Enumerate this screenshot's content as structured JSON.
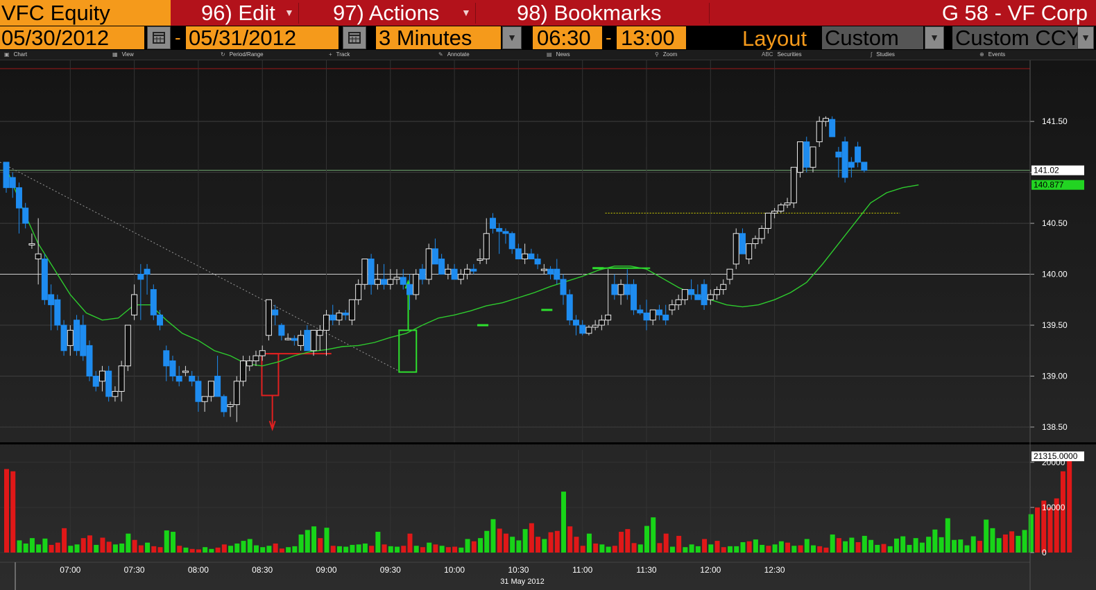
{
  "topbar": {
    "security": "VFC Equity",
    "menu_edit": "96) Edit",
    "menu_actions": "97) Actions",
    "menu_bookmarks": "98) Bookmarks",
    "function_title": "G 58 - VF Corp"
  },
  "controls": {
    "start_date": "05/30/2012",
    "end_date": "05/31/2012",
    "interval": "3 Minutes",
    "start_time": "06:30",
    "end_time": "13:00",
    "layout_label": "Layout",
    "layout_value": "Custom",
    "currency_value": "Custom CCY"
  },
  "toolbar": [
    "Chart",
    "View",
    "Period/Range",
    "Track",
    "Annotate",
    "News",
    "Zoom",
    "Securities",
    "Studies",
    "Events"
  ],
  "colors": {
    "up": "#ffffff",
    "down": "#1e8cf0",
    "ma": "#2ecc2e",
    "vol_up": "#18d418",
    "vol_down": "#e01818",
    "orange": "#f59a1b",
    "red_bar": "#b3121b"
  },
  "chart_data": {
    "type": "candlestick",
    "date_label": "31 May 2012",
    "x_ticks": [
      "07:00",
      "07:30",
      "08:00",
      "08:30",
      "09:00",
      "09:30",
      "10:00",
      "10:30",
      "11:00",
      "11:30",
      "12:00",
      "12:30"
    ],
    "price_ticks": [
      "141.50",
      "141.00",
      "140.50",
      "140.00",
      "139.50",
      "139.00",
      "138.50"
    ],
    "price_range": [
      138.35,
      142.1
    ],
    "volume_ticks": [
      "20000",
      "10000",
      "0"
    ],
    "volume_range": [
      0,
      21500
    ],
    "last_price": "141.02",
    "ma_last": "140.877",
    "volume_last": "21315.0000",
    "time_start": "06:30",
    "bar_minutes": 3,
    "ohlc": [
      [
        141.1,
        141.08,
        140.8,
        140.85
      ],
      [
        140.95,
        141.0,
        140.75,
        140.85
      ],
      [
        140.85,
        140.9,
        140.4,
        140.65
      ],
      [
        140.65,
        140.7,
        140.45,
        140.5
      ],
      [
        140.3,
        140.4,
        140.25,
        140.3
      ],
      [
        140.15,
        140.55,
        139.9,
        140.2
      ],
      [
        140.15,
        140.2,
        139.7,
        139.75
      ],
      [
        139.8,
        139.9,
        139.45,
        139.7
      ],
      [
        139.75,
        139.8,
        139.45,
        139.5
      ],
      [
        139.5,
        139.55,
        139.2,
        139.25
      ],
      [
        139.3,
        139.5,
        139.2,
        139.45
      ],
      [
        139.55,
        139.6,
        139.2,
        139.25
      ],
      [
        139.5,
        139.6,
        139.15,
        139.2
      ],
      [
        139.3,
        139.35,
        138.95,
        139.0
      ],
      [
        139.0,
        139.05,
        138.85,
        138.9
      ],
      [
        138.95,
        139.1,
        138.85,
        139.05
      ],
      [
        139.05,
        139.1,
        138.75,
        138.8
      ],
      [
        138.8,
        138.9,
        138.75,
        138.85
      ],
      [
        138.85,
        139.15,
        138.75,
        139.1
      ],
      [
        139.1,
        139.5,
        139.05,
        139.5
      ],
      [
        139.6,
        139.9,
        139.55,
        139.8
      ],
      [
        140.0,
        140.1,
        139.55,
        139.95
      ],
      [
        140.05,
        140.1,
        139.8,
        140.0
      ],
      [
        139.85,
        139.9,
        139.55,
        139.6
      ],
      [
        139.6,
        139.65,
        139.45,
        139.5
      ],
      [
        139.25,
        139.3,
        138.95,
        139.1
      ],
      [
        139.15,
        139.2,
        138.95,
        139.0
      ],
      [
        139.0,
        139.1,
        138.9,
        138.95
      ],
      [
        139.05,
        139.1,
        139.0,
        139.05
      ],
      [
        139.0,
        139.05,
        138.9,
        138.95
      ],
      [
        138.95,
        139.0,
        138.65,
        138.75
      ],
      [
        138.75,
        138.8,
        138.65,
        138.8
      ],
      [
        138.8,
        138.95,
        138.75,
        138.95
      ],
      [
        139.0,
        139.2,
        138.8,
        138.8
      ],
      [
        138.8,
        138.82,
        138.6,
        138.65
      ],
      [
        138.7,
        138.75,
        138.6,
        138.72
      ],
      [
        138.72,
        139.0,
        138.55,
        138.95
      ],
      [
        138.95,
        139.2,
        138.9,
        139.15
      ],
      [
        139.1,
        139.2,
        139.05,
        139.15
      ],
      [
        139.15,
        139.25,
        139.1,
        139.2
      ],
      [
        139.2,
        139.3,
        139.15,
        139.25
      ],
      [
        139.4,
        139.75,
        139.35,
        139.75
      ],
      [
        139.65,
        139.7,
        139.5,
        139.6
      ],
      [
        139.5,
        139.52,
        139.35,
        139.4
      ],
      [
        139.37,
        139.42,
        139.35,
        139.37
      ],
      [
        139.37,
        139.4,
        139.3,
        139.35
      ],
      [
        139.3,
        139.45,
        139.25,
        139.4
      ],
      [
        139.45,
        139.5,
        139.3,
        139.25
      ],
      [
        139.25,
        139.35,
        139.2,
        139.45
      ],
      [
        139.4,
        139.5,
        139.25,
        139.45
      ],
      [
        139.45,
        139.65,
        139.2,
        139.6
      ],
      [
        139.6,
        139.7,
        139.5,
        139.55
      ],
      [
        139.55,
        139.65,
        139.5,
        139.62
      ],
      [
        139.62,
        139.65,
        139.55,
        139.6
      ],
      [
        139.55,
        139.75,
        139.5,
        139.75
      ],
      [
        139.75,
        139.95,
        139.7,
        139.9
      ],
      [
        139.9,
        140.15,
        139.85,
        140.15
      ],
      [
        140.15,
        140.2,
        139.8,
        139.9
      ],
      [
        139.9,
        140.1,
        139.85,
        139.95
      ],
      [
        139.95,
        140.1,
        139.85,
        139.9
      ],
      [
        139.9,
        140.05,
        139.85,
        139.95
      ],
      [
        139.95,
        140.05,
        139.9,
        139.97
      ],
      [
        139.97,
        140.05,
        139.85,
        139.9
      ],
      [
        139.9,
        140.0,
        139.65,
        139.8
      ],
      [
        139.8,
        140.05,
        139.75,
        140.0
      ],
      [
        140.05,
        140.1,
        139.9,
        139.95
      ],
      [
        139.95,
        140.3,
        139.9,
        140.25
      ],
      [
        140.25,
        140.35,
        140.1,
        140.1
      ],
      [
        140.15,
        140.2,
        140.0,
        140.0
      ],
      [
        140.0,
        140.1,
        139.95,
        140.05
      ],
      [
        140.05,
        140.1,
        139.95,
        139.95
      ],
      [
        139.95,
        140.05,
        139.9,
        140.0
      ],
      [
        140.0,
        140.1,
        139.95,
        140.05
      ],
      [
        140.05,
        140.1,
        140.0,
        140.03
      ],
      [
        140.15,
        140.25,
        140.1,
        140.15
      ],
      [
        140.15,
        140.55,
        140.1,
        140.4
      ],
      [
        140.55,
        140.6,
        140.4,
        140.45
      ],
      [
        140.45,
        140.5,
        140.2,
        140.42
      ],
      [
        140.42,
        140.45,
        140.3,
        140.4
      ],
      [
        140.4,
        140.42,
        140.2,
        140.25
      ],
      [
        140.25,
        140.3,
        140.15,
        140.15
      ],
      [
        140.15,
        140.3,
        140.1,
        140.2
      ],
      [
        140.2,
        140.25,
        140.15,
        140.15
      ],
      [
        140.15,
        140.2,
        140.05,
        140.1
      ],
      [
        140.05,
        140.1,
        140.0,
        140.05
      ],
      [
        140.05,
        140.08,
        139.95,
        140.0
      ],
      [
        140.05,
        140.15,
        139.9,
        139.95
      ],
      [
        139.95,
        140.0,
        139.7,
        139.8
      ],
      [
        139.8,
        139.85,
        139.5,
        139.55
      ],
      [
        139.55,
        139.6,
        139.4,
        139.5
      ],
      [
        139.5,
        139.55,
        139.4,
        139.42
      ],
      [
        139.42,
        139.5,
        139.4,
        139.48
      ],
      [
        139.48,
        139.55,
        139.45,
        139.5
      ],
      [
        139.5,
        139.6,
        139.45,
        139.55
      ],
      [
        139.55,
        140.05,
        139.5,
        139.6
      ],
      [
        139.9,
        140.0,
        139.75,
        139.8
      ],
      [
        139.8,
        139.95,
        139.7,
        139.9
      ],
      [
        139.9,
        140.05,
        139.75,
        139.8
      ],
      [
        139.9,
        139.95,
        139.6,
        139.65
      ],
      [
        139.65,
        139.7,
        139.6,
        139.62
      ],
      [
        139.62,
        139.75,
        139.45,
        139.55
      ],
      [
        139.55,
        139.65,
        139.5,
        139.65
      ],
      [
        139.65,
        139.7,
        139.55,
        139.6
      ],
      [
        139.6,
        139.7,
        139.5,
        139.55
      ],
      [
        139.65,
        139.75,
        139.6,
        139.7
      ],
      [
        139.7,
        139.8,
        139.65,
        139.75
      ],
      [
        139.75,
        139.85,
        139.7,
        139.85
      ],
      [
        139.85,
        139.95,
        139.75,
        139.8
      ],
      [
        139.8,
        139.9,
        139.75,
        139.75
      ],
      [
        139.9,
        139.95,
        139.65,
        139.7
      ],
      [
        139.75,
        139.85,
        139.7,
        139.8
      ],
      [
        139.8,
        139.88,
        139.75,
        139.85
      ],
      [
        139.85,
        139.95,
        139.8,
        139.9
      ],
      [
        139.95,
        140.05,
        139.9,
        140.05
      ],
      [
        140.1,
        140.45,
        140.05,
        140.4
      ],
      [
        140.4,
        140.45,
        140.2,
        140.2
      ],
      [
        140.15,
        140.3,
        140.1,
        140.3
      ],
      [
        140.3,
        140.38,
        140.25,
        140.35
      ],
      [
        140.35,
        140.48,
        140.3,
        140.45
      ],
      [
        140.45,
        140.6,
        140.4,
        140.6
      ],
      [
        140.6,
        140.65,
        140.55,
        140.62
      ],
      [
        140.62,
        140.7,
        140.6,
        140.68
      ],
      [
        140.68,
        140.75,
        140.65,
        140.7
      ],
      [
        140.7,
        141.05,
        140.65,
        141.05
      ],
      [
        141.0,
        141.3,
        140.95,
        141.3
      ],
      [
        141.3,
        141.35,
        141.0,
        141.05
      ],
      [
        141.05,
        141.25,
        141.0,
        141.25
      ],
      [
        141.3,
        141.55,
        141.25,
        141.5
      ],
      [
        141.5,
        141.55,
        141.45,
        141.53
      ],
      [
        141.52,
        141.55,
        141.35,
        141.35
      ],
      [
        141.2,
        141.25,
        140.95,
        141.15
      ],
      [
        141.3,
        141.35,
        140.9,
        140.95
      ],
      [
        141.1,
        141.15,
        140.95,
        141.05
      ],
      [
        141.25,
        141.3,
        141.05,
        141.1
      ],
      [
        141.1,
        141.1,
        141.0,
        141.02
      ]
    ],
    "volume": [
      18500,
      18000,
      2700,
      2000,
      3200,
      1800,
      3100,
      1700,
      2200,
      5400,
      1500,
      1800,
      3200,
      3800,
      1700,
      3300,
      2400,
      1800,
      2000,
      4200,
      2800,
      1600,
      2200,
      1400,
      1200,
      4900,
      4600,
      1500,
      1100,
      800,
      700,
      1200,
      800,
      1100,
      1800,
      1500,
      2000,
      2600,
      3000,
      1600,
      1200,
      1500,
      2000,
      900,
      1200,
      1400,
      4000,
      5000,
      5800,
      3200,
      5500,
      1500,
      1400,
      1300,
      1700,
      1800,
      2000,
      1500,
      4600,
      1800,
      1400,
      1300,
      1500,
      4200,
      1500,
      1200,
      2200,
      1800,
      1500,
      1200,
      1300,
      1100,
      3000,
      2500,
      3200,
      4800,
      7400,
      5300,
      4200,
      3500,
      2700,
      5200,
      6500,
      3500,
      3000,
      4500,
      4800,
      13500,
      5800,
      3500,
      1500,
      4200,
      2000,
      1800,
      1300,
      1500,
      4600,
      5200,
      2100,
      1800,
      5900,
      7800,
      2100,
      4200,
      1300,
      3700,
      1200,
      1800,
      1400,
      3000,
      1800,
      2600,
      1200,
      1400,
      1400,
      2300,
      2500,
      2900,
      1700,
      1500,
      1800,
      2500,
      2200,
      1500,
      1600,
      3000,
      1600,
      1400,
      1100,
      4000,
      3200,
      2500,
      3300,
      2300,
      3700,
      2800,
      1700,
      1900,
      1400,
      3100,
      3600,
      1700,
      3200,
      2200,
      3500,
      5100,
      3400,
      7600,
      2800,
      2900,
      1600,
      3600,
      2600,
      7300,
      5400,
      3200,
      4000,
      4700,
      3700,
      5000,
      8500,
      10000,
      11500,
      10000,
      12000,
      18000,
      21315
    ],
    "volume_up": [
      0,
      0,
      1,
      1,
      1,
      1,
      1,
      0,
      0,
      0,
      1,
      1,
      0,
      0,
      1,
      0,
      0,
      1,
      1,
      1,
      0,
      0,
      1,
      0,
      0,
      1,
      1,
      0,
      1,
      0,
      0,
      1,
      1,
      0,
      0,
      1,
      1,
      1,
      1,
      1,
      1,
      1,
      0,
      0,
      1,
      1,
      1,
      1,
      1,
      0,
      1,
      0,
      1,
      1,
      1,
      1,
      1,
      0,
      1,
      0,
      1,
      1,
      0,
      0,
      1,
      0,
      1,
      0,
      1,
      0,
      0,
      1,
      1,
      0,
      1,
      1,
      1,
      0,
      0,
      1,
      1,
      1,
      0,
      0,
      1,
      0,
      0,
      1,
      0,
      0,
      0,
      1,
      0,
      1,
      1,
      0,
      0,
      0,
      0,
      1,
      1,
      1,
      0,
      0,
      1,
      0,
      1,
      1,
      1,
      0,
      1,
      0,
      0,
      1,
      1,
      1,
      0,
      1,
      1,
      0,
      1,
      1,
      0,
      1,
      0,
      1,
      1,
      0,
      0,
      1,
      0,
      1,
      1,
      0,
      1,
      1,
      1,
      0,
      1,
      1,
      1,
      1,
      1,
      1,
      1,
      1,
      1,
      1,
      1,
      1,
      1,
      1,
      0,
      1,
      1,
      1,
      0,
      0,
      1,
      1,
      1
    ],
    "ma": [
      [
        0,
        141.05
      ],
      [
        10,
        140.65
      ],
      [
        20,
        140.3
      ],
      [
        30,
        140.05
      ],
      [
        40,
        139.8
      ],
      [
        50,
        139.62
      ],
      [
        60,
        139.55
      ],
      [
        70,
        139.57
      ],
      [
        80,
        139.7
      ],
      [
        90,
        139.7
      ],
      [
        100,
        139.55
      ],
      [
        110,
        139.42
      ],
      [
        120,
        139.35
      ],
      [
        130,
        139.25
      ],
      [
        140,
        139.2
      ],
      [
        150,
        139.12
      ],
      [
        160,
        139.1
      ],
      [
        170,
        139.14
      ],
      [
        180,
        139.2
      ],
      [
        190,
        139.24
      ],
      [
        200,
        139.26
      ],
      [
        210,
        139.29
      ],
      [
        220,
        139.3
      ],
      [
        230,
        139.33
      ],
      [
        240,
        139.38
      ],
      [
        250,
        139.42
      ],
      [
        260,
        139.5
      ],
      [
        270,
        139.57
      ],
      [
        280,
        139.6
      ],
      [
        290,
        139.64
      ],
      [
        300,
        139.69
      ],
      [
        310,
        139.72
      ],
      [
        320,
        139.77
      ],
      [
        330,
        139.82
      ],
      [
        340,
        139.88
      ],
      [
        350,
        139.93
      ],
      [
        360,
        139.98
      ],
      [
        370,
        140.04
      ],
      [
        380,
        140.08
      ],
      [
        390,
        140.08
      ],
      [
        400,
        140.05
      ],
      [
        410,
        139.96
      ],
      [
        420,
        139.87
      ],
      [
        430,
        139.8
      ],
      [
        440,
        139.75
      ],
      [
        450,
        139.7
      ],
      [
        460,
        139.68
      ],
      [
        470,
        139.7
      ],
      [
        480,
        139.75
      ],
      [
        490,
        139.82
      ],
      [
        500,
        139.92
      ],
      [
        510,
        140.1
      ],
      [
        520,
        140.3
      ],
      [
        530,
        140.5
      ],
      [
        540,
        140.7
      ],
      [
        550,
        140.8
      ],
      [
        560,
        140.85
      ],
      [
        570,
        140.877
      ]
    ]
  }
}
